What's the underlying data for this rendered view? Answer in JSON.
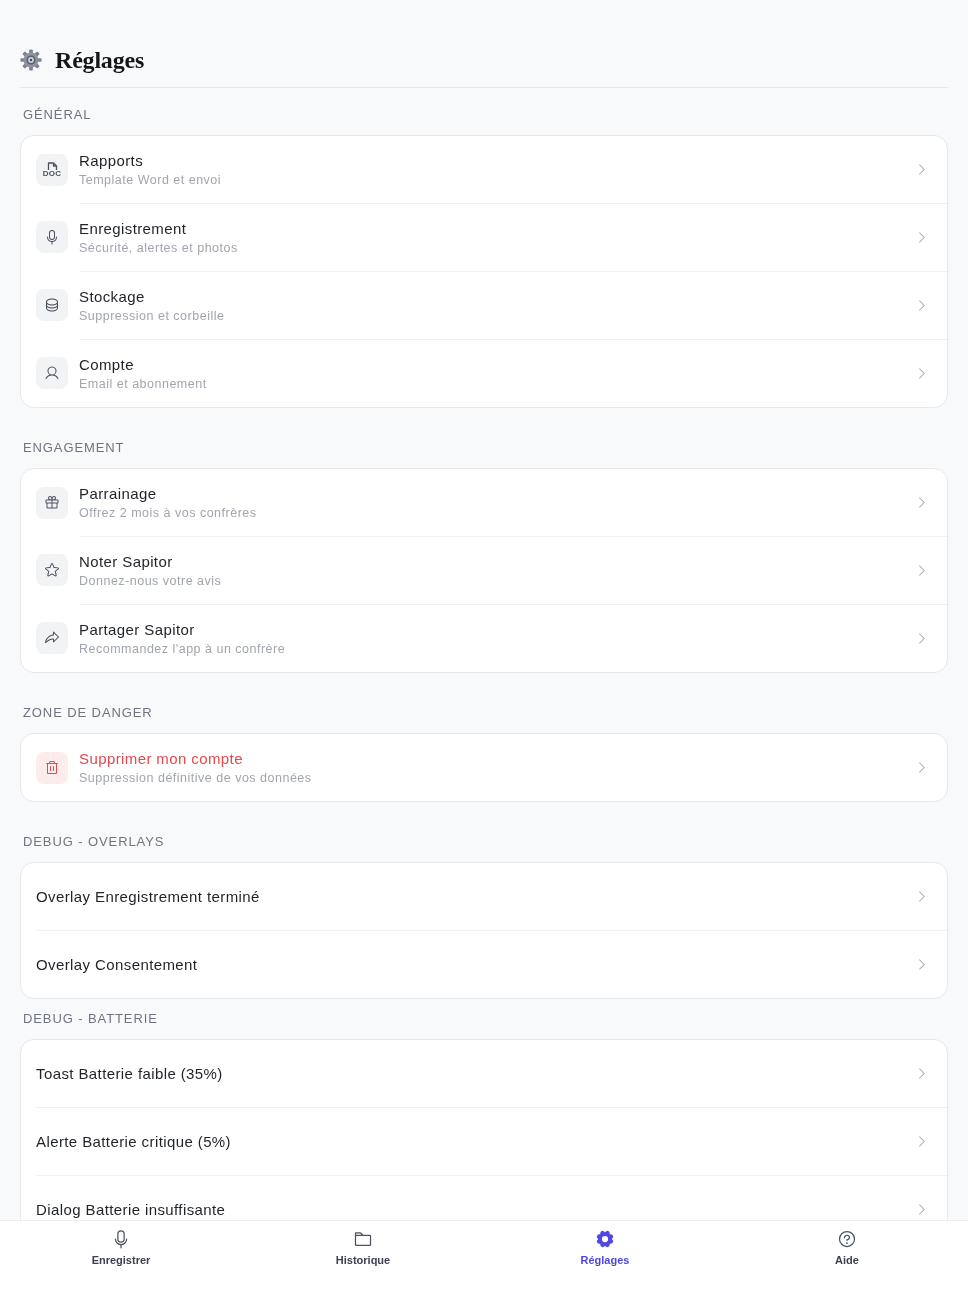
{
  "header": {
    "title": "Réglages"
  },
  "sections": [
    {
      "title": "GÉNÉRAL",
      "rows": [
        {
          "kind": "icon",
          "title": "Rapports",
          "subtitle": "Template Word et envoi",
          "icon_text": "DOC"
        },
        {
          "kind": "icon",
          "title": "Enregistrement",
          "subtitle": "Sécurité, alertes et photos"
        },
        {
          "kind": "icon",
          "title": "Stockage",
          "subtitle": "Suppression et corbeille"
        },
        {
          "kind": "icon",
          "title": "Compte",
          "subtitle": "Email et abonnement"
        }
      ]
    },
    {
      "title": "ENGAGEMENT",
      "rows": [
        {
          "kind": "icon",
          "title": "Parrainage",
          "subtitle": "Offrez 2 mois à vos confrères"
        },
        {
          "kind": "icon",
          "title": "Noter Sapitor",
          "subtitle": "Donnez-nous votre avis"
        },
        {
          "kind": "icon",
          "title": "Partager Sapitor",
          "subtitle": "Recommandez l'app à un confrère"
        }
      ]
    },
    {
      "title": "ZONE DE DANGER",
      "rows": [
        {
          "kind": "danger",
          "title": "Supprimer mon compte",
          "subtitle": "Suppression définitive de vos données"
        }
      ]
    },
    {
      "title": "DEBUG - OVERLAYS",
      "rows": [
        {
          "kind": "plain",
          "title": "Overlay Enregistrement terminé"
        },
        {
          "kind": "plain",
          "title": "Overlay Consentement"
        }
      ]
    },
    {
      "title": "DEBUG - BATTERIE",
      "rows": [
        {
          "kind": "plain",
          "title": "Toast Batterie faible (35%)"
        },
        {
          "kind": "plain",
          "title": "Alerte Batterie critique (5%)"
        },
        {
          "kind": "plain",
          "title": "Dialog Batterie insuffisante"
        }
      ]
    }
  ],
  "tab_bar": {
    "tabs": [
      {
        "label": "Enregistrer",
        "selected": false
      },
      {
        "label": "Historique",
        "selected": false
      },
      {
        "label": "Réglages",
        "selected": true
      },
      {
        "label": "Aide",
        "selected": false
      }
    ]
  }
}
